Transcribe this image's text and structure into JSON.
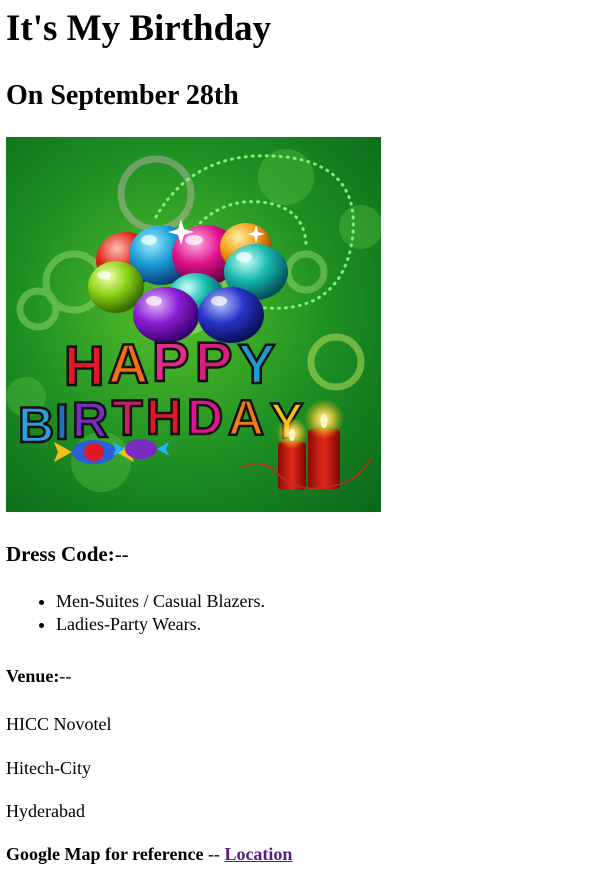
{
  "header": {
    "title": "It's My Birthday",
    "subtitle": "On September 28th"
  },
  "banner": {
    "icon": "happy-birthday-image",
    "line1": "HAPPY",
    "line2": "BIRTHDAY",
    "background_color": "#0b7a1e"
  },
  "dress_code": {
    "label": "Dress Code:",
    "suffix": "--",
    "items": [
      "Men-Suites / Casual Blazers.",
      "Ladies-Party Wears."
    ]
  },
  "venue": {
    "label": "Venue:",
    "suffix": "--",
    "lines": [
      "HICC Novotel",
      "Hitech-City",
      "Hyderabad"
    ]
  },
  "map": {
    "label": "Google Map for reference",
    "separator": " -- ",
    "link_text": "Location",
    "link_color": "#551a8b"
  }
}
